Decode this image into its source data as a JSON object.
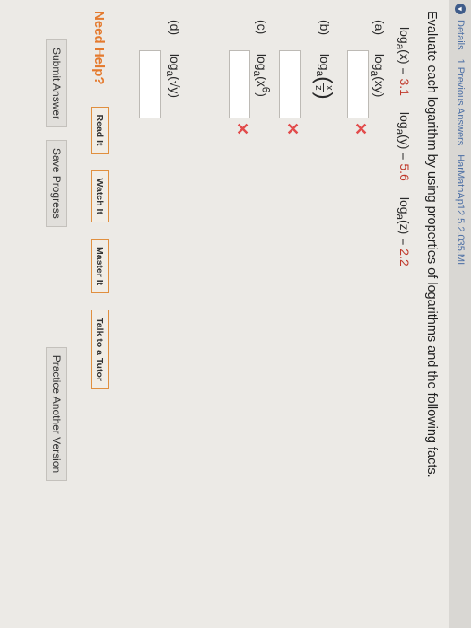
{
  "topbar": {
    "crumbs": [
      "Details",
      "1 Previous Answers",
      "HarMathAp12 5.2.035.MI."
    ]
  },
  "question": "Evaluate each logarithm by using properties of logarithms and the following facts.",
  "facts": [
    {
      "label": "log",
      "sub": "a",
      "arg": "(x) = ",
      "value": "3.1"
    },
    {
      "label": "log",
      "sub": "a",
      "arg": "(y) = ",
      "value": "5.6"
    },
    {
      "label": "log",
      "sub": "a",
      "arg": "(z) = ",
      "value": "2.2"
    }
  ],
  "parts": [
    {
      "letter": "(a)",
      "expr_pre": "log",
      "sub": "a",
      "expr_post": "(xy)"
    },
    {
      "letter": "(b)",
      "expr_pre": "log",
      "sub": "a",
      "frac_num": "x",
      "frac_den": "z"
    },
    {
      "letter": "(c)",
      "expr_pre": "log",
      "sub": "a",
      "expr_post": "(x",
      "sup": "6",
      "expr_end": ")"
    },
    {
      "letter": "(d)",
      "expr_pre": "log",
      "sub": "a",
      "expr_post": "(√y)"
    }
  ],
  "wrong_mark": "✕",
  "help": {
    "title": "Need Help?",
    "buttons": [
      "Read It",
      "Watch It",
      "Master It",
      "Talk to a Tutor"
    ]
  },
  "actions": [
    "Submit Answer",
    "Save Progress",
    "Practice Another Version"
  ],
  "colors": {
    "accent_orange": "#e47a2e",
    "error_red": "#e24b4b",
    "fact_red": "#c0392b"
  }
}
